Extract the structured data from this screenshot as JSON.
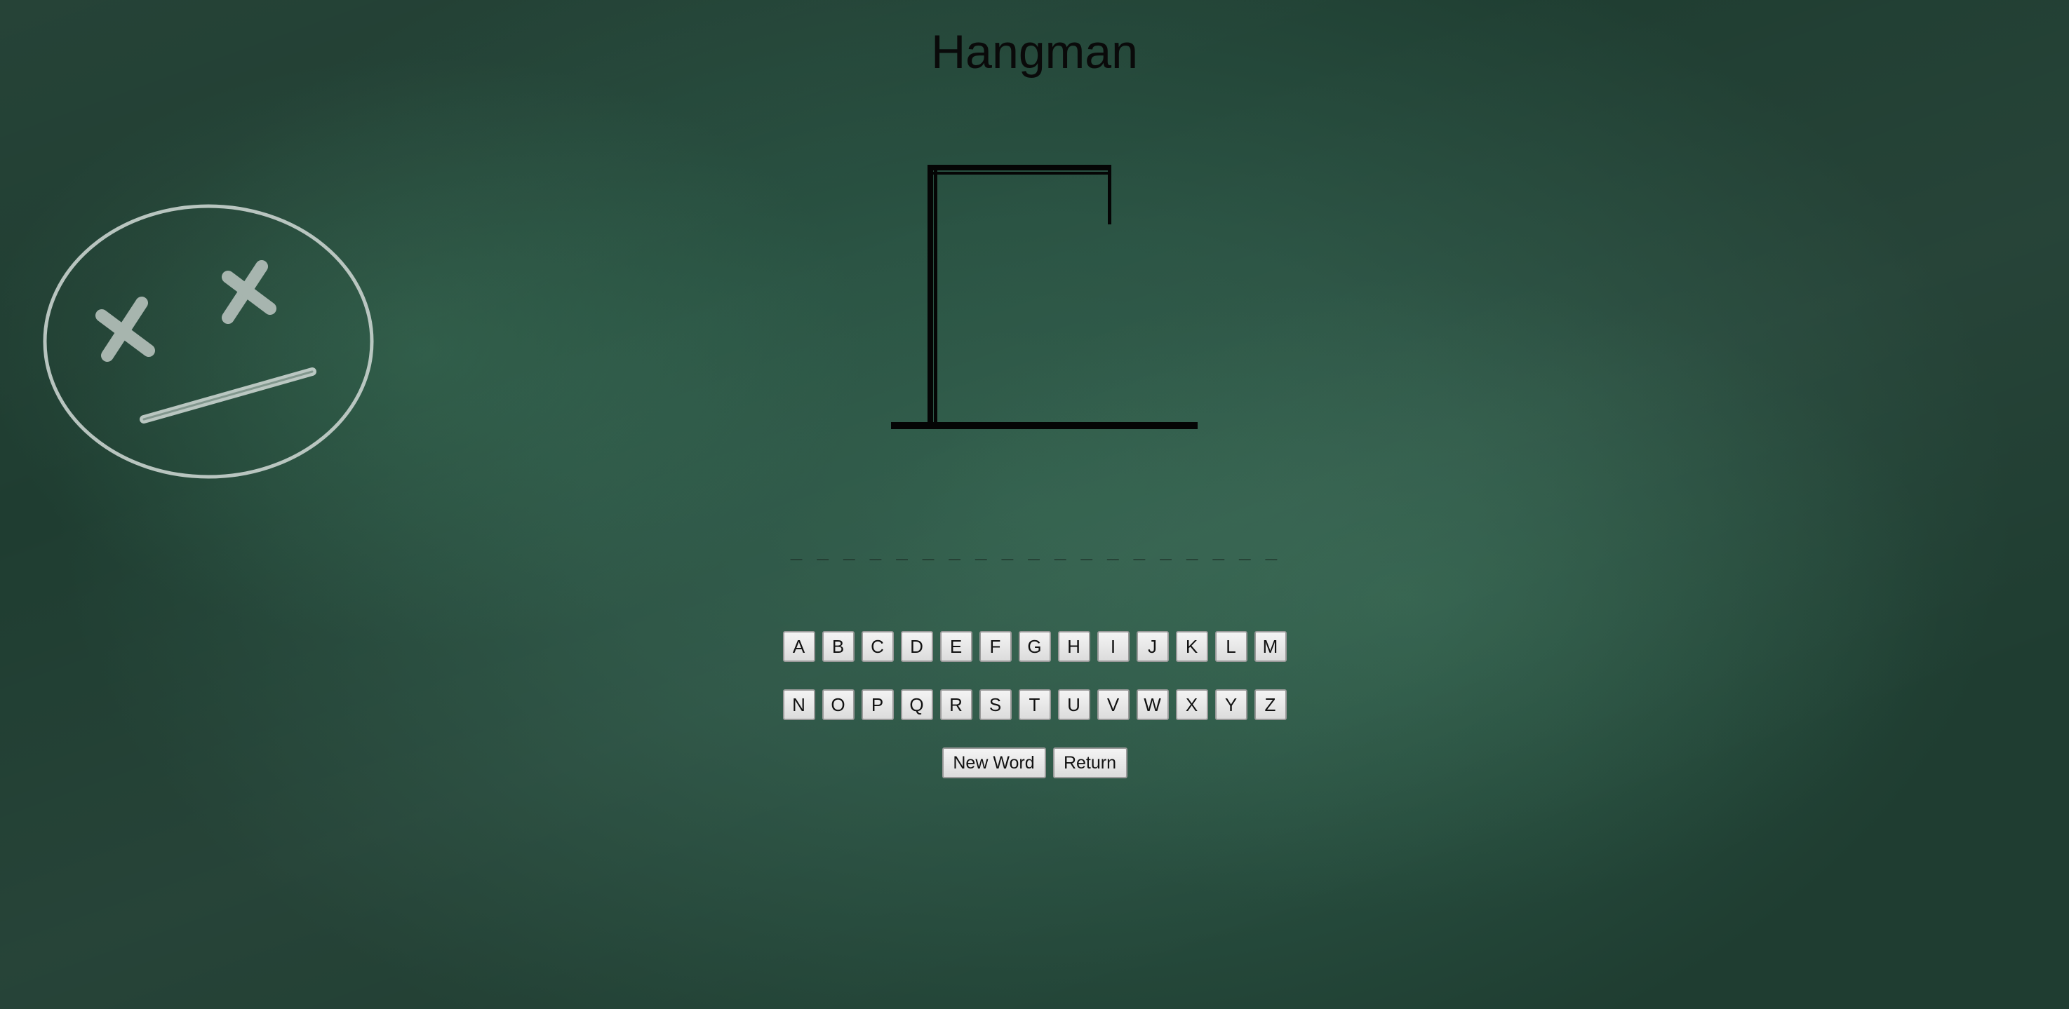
{
  "title": "Hangman",
  "word": {
    "blanks": "_ _ _ _ _ _ _ _ _ _ _ _ _ _ _ _ _ _ _"
  },
  "keyboard": {
    "row1": [
      "A",
      "B",
      "C",
      "D",
      "E",
      "F",
      "G",
      "H",
      "I",
      "J",
      "K",
      "L",
      "M"
    ],
    "row2": [
      "N",
      "O",
      "P",
      "Q",
      "R",
      "S",
      "T",
      "U",
      "V",
      "W",
      "X",
      "Y",
      "Z"
    ]
  },
  "controls": {
    "new_word_label": "New Word",
    "return_label": "Return"
  },
  "decor": {
    "face_icon": "dead-face-icon",
    "gallows_icon": "gallows-icon",
    "chalk_color": "#c9d3ce",
    "board_color": "#2a5343"
  }
}
